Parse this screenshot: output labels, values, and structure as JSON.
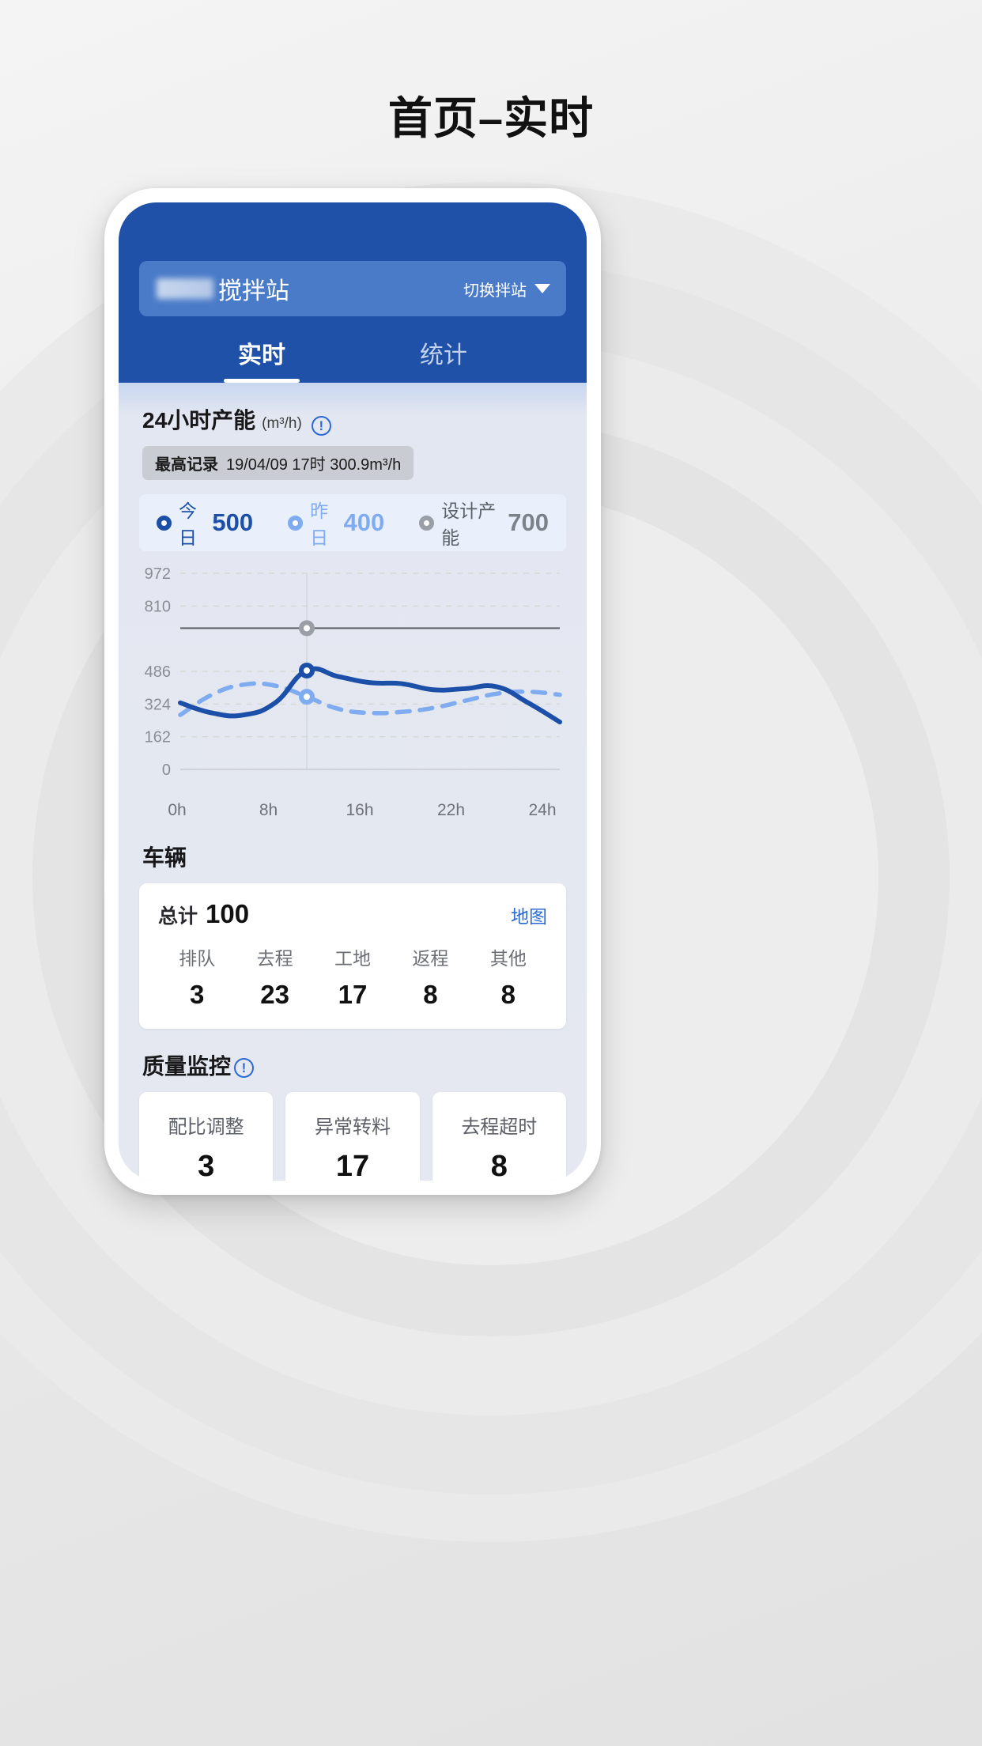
{
  "page": {
    "title": "首页–实时"
  },
  "header": {
    "station": {
      "name": "搅拌站",
      "redacted_prefix": true
    },
    "switch_label": "切换拌站",
    "caret_icon": "chevron-down-icon"
  },
  "tabs": [
    {
      "label": "实时",
      "active": true
    },
    {
      "label": "统计",
      "active": false
    }
  ],
  "capacity": {
    "title": "24小时产能",
    "unit": "(m³/h)",
    "info_icon": "info-exclamation-icon",
    "record": {
      "label": "最高记录",
      "value": "19/04/09 17时 300.9m³/h"
    },
    "legend": [
      {
        "name": "今日",
        "value": "500",
        "color": "#1b4fa8"
      },
      {
        "name": "昨日",
        "value": "400",
        "color": "#7fabf0"
      },
      {
        "name": "设计产能",
        "value": "700",
        "color": "#9a9ea6"
      }
    ]
  },
  "chart_data": {
    "type": "line",
    "title": "24小时产能 (m³/h)",
    "xlabel": "",
    "ylabel": "m³/h",
    "grid": true,
    "legend_position": "above-chart",
    "x": [
      0,
      2,
      4,
      6,
      8,
      10,
      12,
      14,
      16,
      18,
      20,
      22,
      24
    ],
    "xtick_labels": [
      "0h",
      "8h",
      "16h",
      "22h",
      "24h"
    ],
    "xtick_values": [
      0,
      8,
      16,
      22,
      24
    ],
    "ytick_labels": [
      "972",
      "810",
      "486",
      "324",
      "162",
      "0"
    ],
    "ytick_values": [
      972,
      810,
      486,
      324,
      162,
      0
    ],
    "ylim": [
      0,
      972
    ],
    "series": [
      {
        "name": "今日",
        "style": "solid",
        "color": "#1b4fa8",
        "values": [
          330,
          280,
          270,
          330,
          490,
          460,
          430,
          425,
          395,
          400,
          410,
          330,
          235
        ]
      },
      {
        "name": "昨日",
        "style": "dashed",
        "color": "#7fabf0",
        "values": [
          270,
          370,
          420,
          415,
          360,
          300,
          280,
          285,
          305,
          340,
          375,
          385,
          370
        ]
      },
      {
        "name": "设计产能",
        "style": "reference-line",
        "color": "#5c5f66",
        "values": [
          700,
          700,
          700,
          700,
          700,
          700,
          700,
          700,
          700,
          700,
          700,
          700,
          700
        ]
      }
    ],
    "markers": [
      {
        "series": "设计产能",
        "x": 8,
        "y": 700,
        "color": "#9a9ea6"
      },
      {
        "series": "今日",
        "x": 8,
        "y": 490,
        "color": "#1b4fa8"
      },
      {
        "series": "昨日",
        "x": 8,
        "y": 360,
        "color": "#7fabf0"
      }
    ],
    "crosshair_x": 8
  },
  "vehicles": {
    "section_title": "车辆",
    "total_label": "总计",
    "total_value": "100",
    "map_link": "地图",
    "stats": [
      {
        "label": "排队",
        "value": "3"
      },
      {
        "label": "去程",
        "value": "23"
      },
      {
        "label": "工地",
        "value": "17"
      },
      {
        "label": "返程",
        "value": "8"
      },
      {
        "label": "其他",
        "value": "8"
      }
    ]
  },
  "quality": {
    "section_title": "质量监控",
    "info_icon": "info-exclamation-icon",
    "cards": [
      {
        "label": "配比调整",
        "value": "3"
      },
      {
        "label": "异常转料",
        "value": "17"
      },
      {
        "label": "去程超时",
        "value": "8"
      }
    ]
  }
}
